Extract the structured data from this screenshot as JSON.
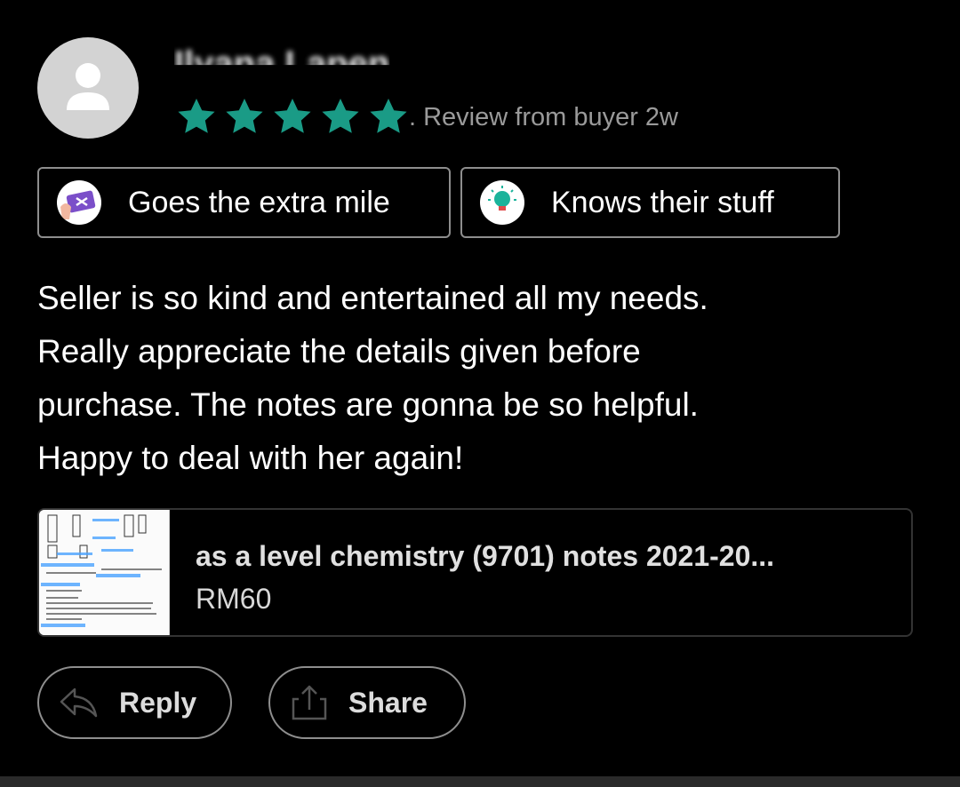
{
  "reviewer": {
    "name": "Ilyana Lapen",
    "avatar_icon": "user-icon",
    "rating": 5,
    "review_source": ". Review from buyer",
    "time_ago": "2w",
    "star_color": "#1a9b86"
  },
  "badges": [
    {
      "icon": "plane-ticket-icon",
      "label": "Goes the extra mile"
    },
    {
      "icon": "lightbulb-icon",
      "label": "Knows their stuff"
    }
  ],
  "review_text": {
    "line1": "Seller is so kind and entertained all my needs.",
    "line2": "Really appreciate the details given before",
    "line3": "purchase. The notes are gonna be so helpful.",
    "line4": "Happy to deal with her again!"
  },
  "product": {
    "title": "as a level chemistry (9701) notes 2021-20...",
    "price": "RM60"
  },
  "actions": {
    "reply_label": "Reply",
    "share_label": "Share"
  }
}
